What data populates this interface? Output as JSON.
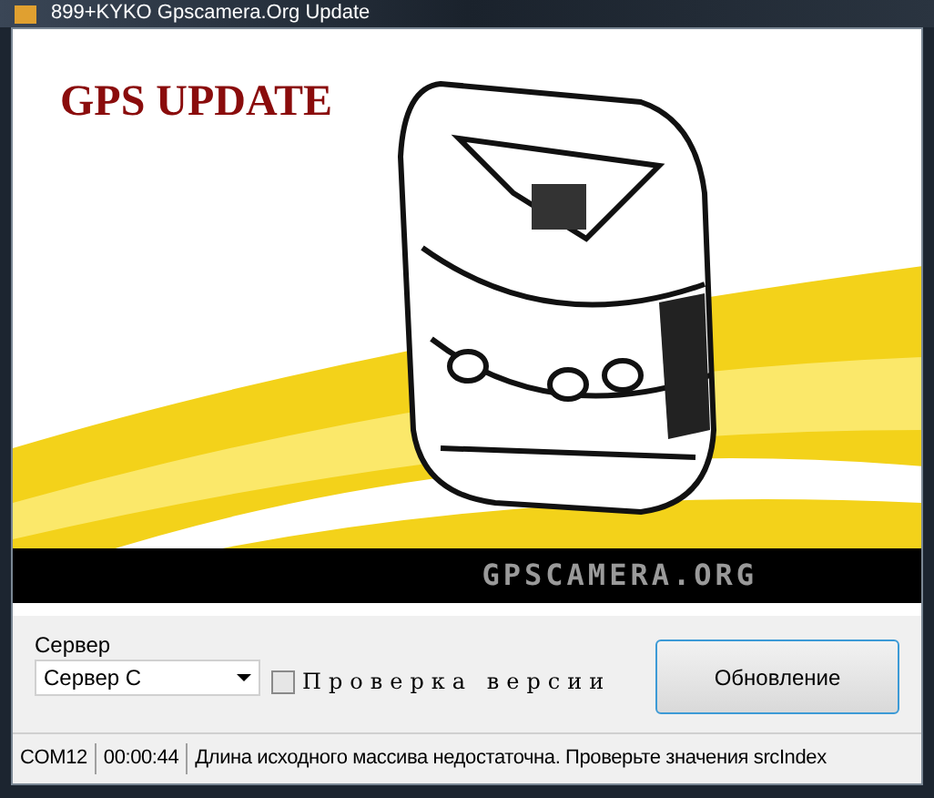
{
  "window": {
    "title": "899+KYKO  Gpscamera.Org Update"
  },
  "banner": {
    "heading": "GPS UPDATE",
    "logo": "GPSCAMERA.ORG"
  },
  "server": {
    "label": "Сервер",
    "value": "Сервер С"
  },
  "version_check": {
    "label": "Проверка версии",
    "checked": false
  },
  "update_button": {
    "label": "Обновление"
  },
  "status_bar": [
    "COM12",
    "00:00:44",
    "Длина исходного массива недостаточна. Проверьте значения srcIndex"
  ]
}
